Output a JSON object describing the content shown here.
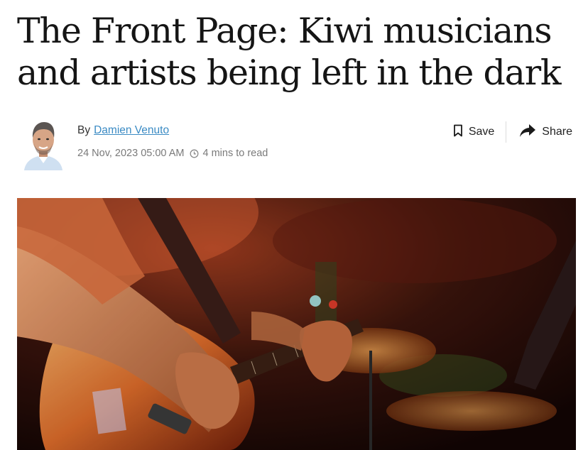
{
  "article": {
    "headline": "The Front Page: Kiwi musicians and artists being left in the dark",
    "byline": {
      "by": "By",
      "author": "Damien Venuto",
      "date": "24 Nov, 2023 05:00 AM",
      "read_time": "4 mins to read"
    },
    "actions": {
      "save_label": "Save",
      "share_label": "Share"
    }
  },
  "icons": {
    "save": "bookmark-icon",
    "share": "share-arrow-icon",
    "clock": "clock-icon"
  },
  "colors": {
    "author_link": "#3b8bc4",
    "meta_text": "#7a7a7a",
    "headline": "#151515"
  }
}
